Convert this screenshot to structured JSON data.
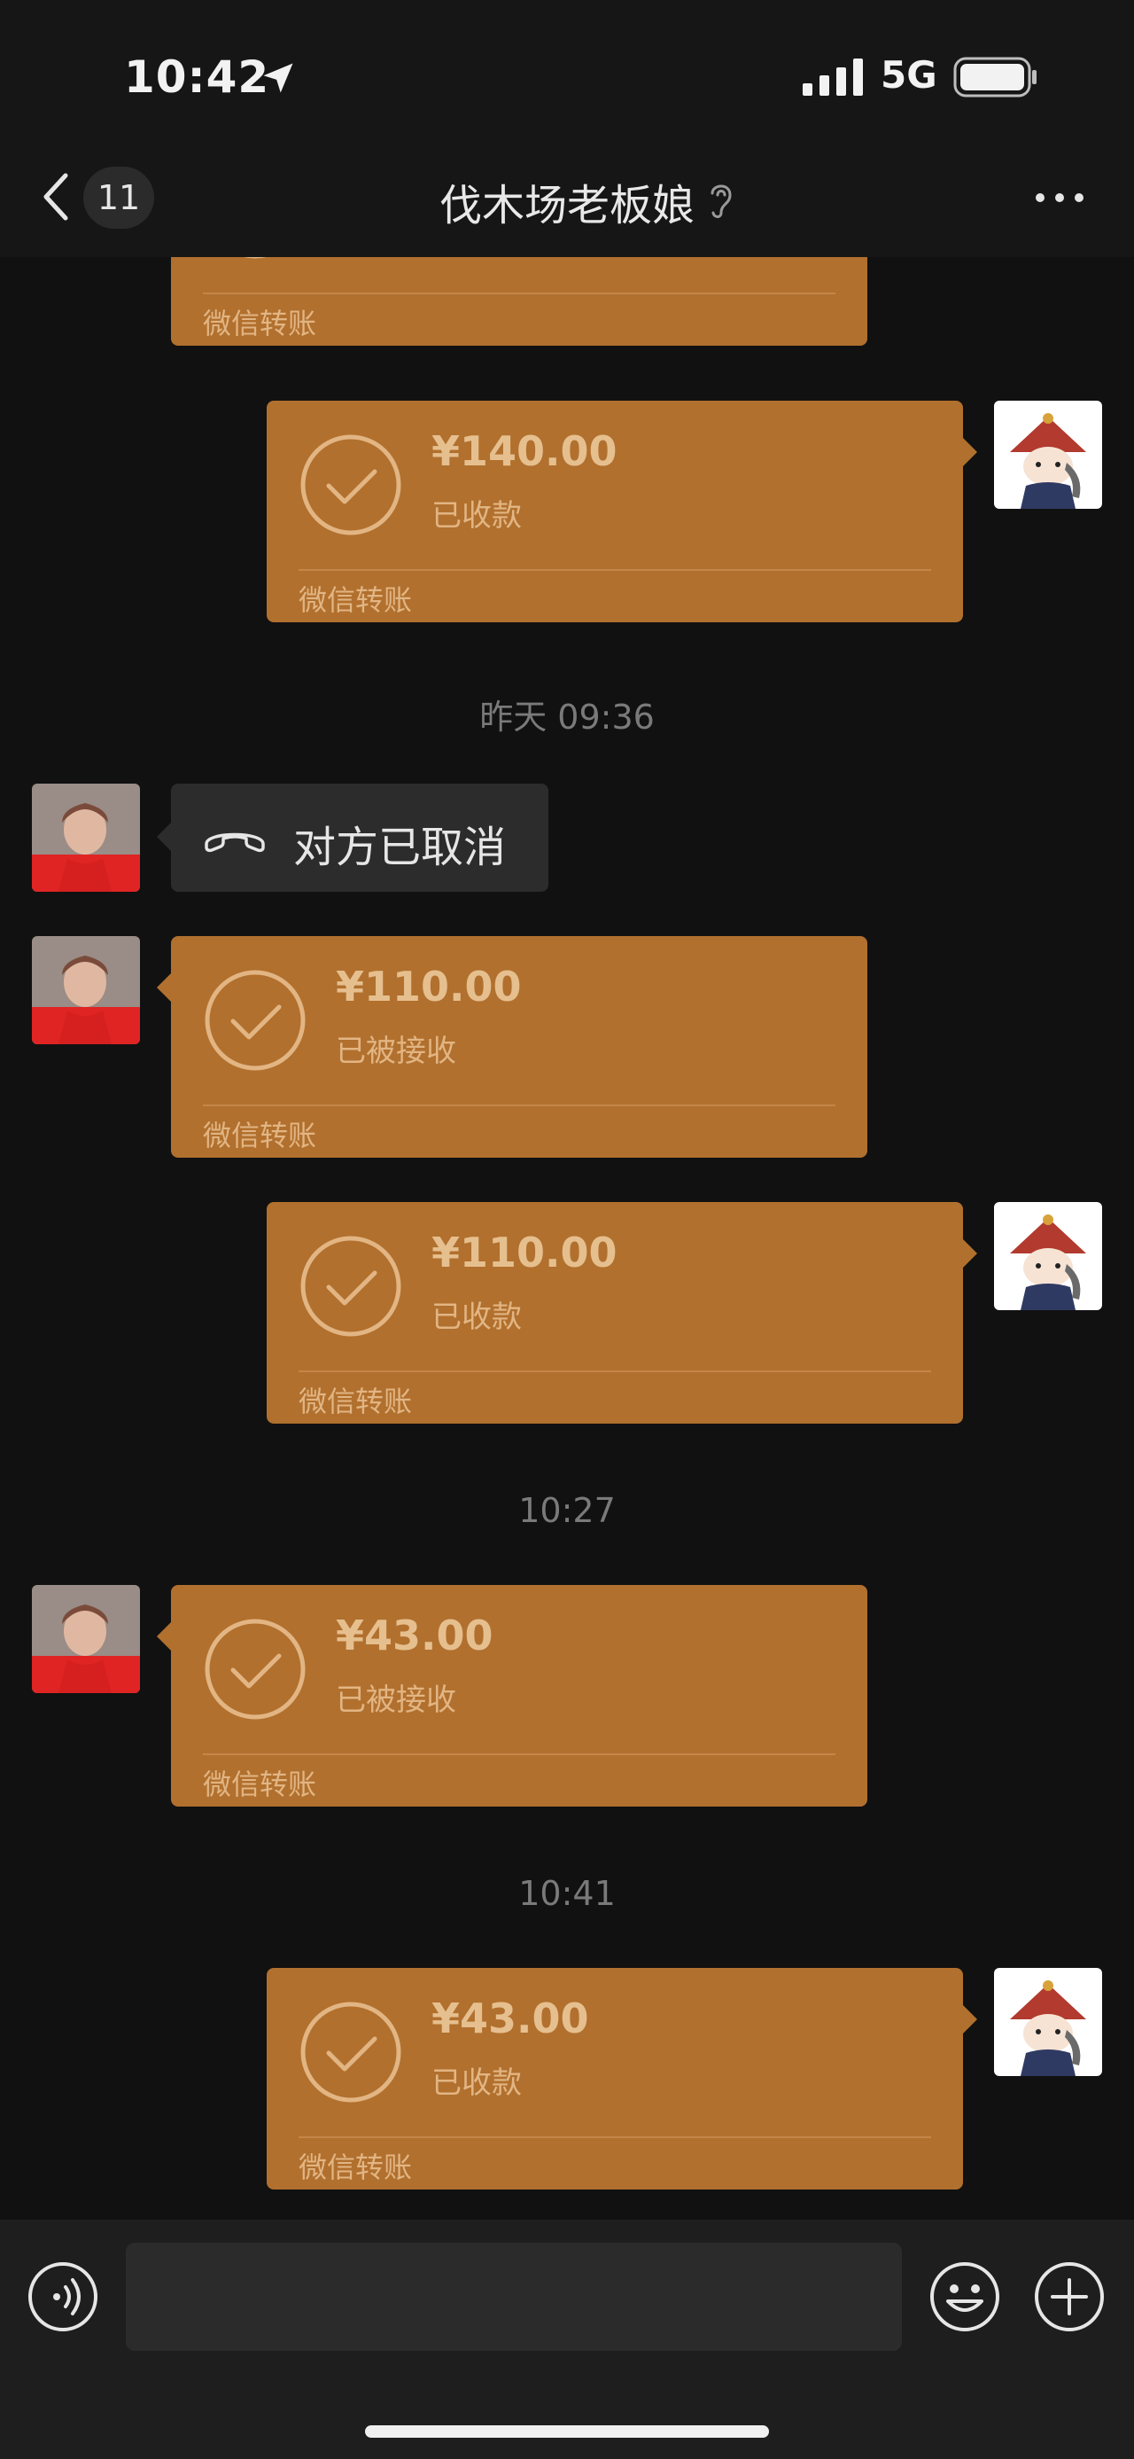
{
  "status_bar": {
    "time": "10:42",
    "network": "5G"
  },
  "nav": {
    "unread_count": "11",
    "title": "伐木场老板娘"
  },
  "colors": {
    "transfer_bg": "#b1702e",
    "background": "#111111"
  },
  "messages": [
    {
      "type": "transfer",
      "side": "left",
      "amount": "",
      "status": "",
      "label": "微信转账"
    },
    {
      "type": "transfer",
      "side": "right",
      "amount": "¥140.00",
      "status": "已收款",
      "label": "微信转账"
    },
    {
      "type": "time",
      "text": "昨天 09:36"
    },
    {
      "type": "call",
      "side": "left",
      "text": "对方已取消"
    },
    {
      "type": "transfer",
      "side": "left",
      "amount": "¥110.00",
      "status": "已被接收",
      "label": "微信转账"
    },
    {
      "type": "transfer",
      "side": "right",
      "amount": "¥110.00",
      "status": "已收款",
      "label": "微信转账"
    },
    {
      "type": "time",
      "text": "10:27"
    },
    {
      "type": "transfer",
      "side": "left",
      "amount": "¥43.00",
      "status": "已被接收",
      "label": "微信转账"
    },
    {
      "type": "time",
      "text": "10:41"
    },
    {
      "type": "transfer",
      "side": "right",
      "amount": "¥43.00",
      "status": "已收款",
      "label": "微信转账"
    }
  ],
  "input_bar": {
    "icons": [
      "voice-icon",
      "emoji-icon",
      "plus-icon"
    ]
  }
}
